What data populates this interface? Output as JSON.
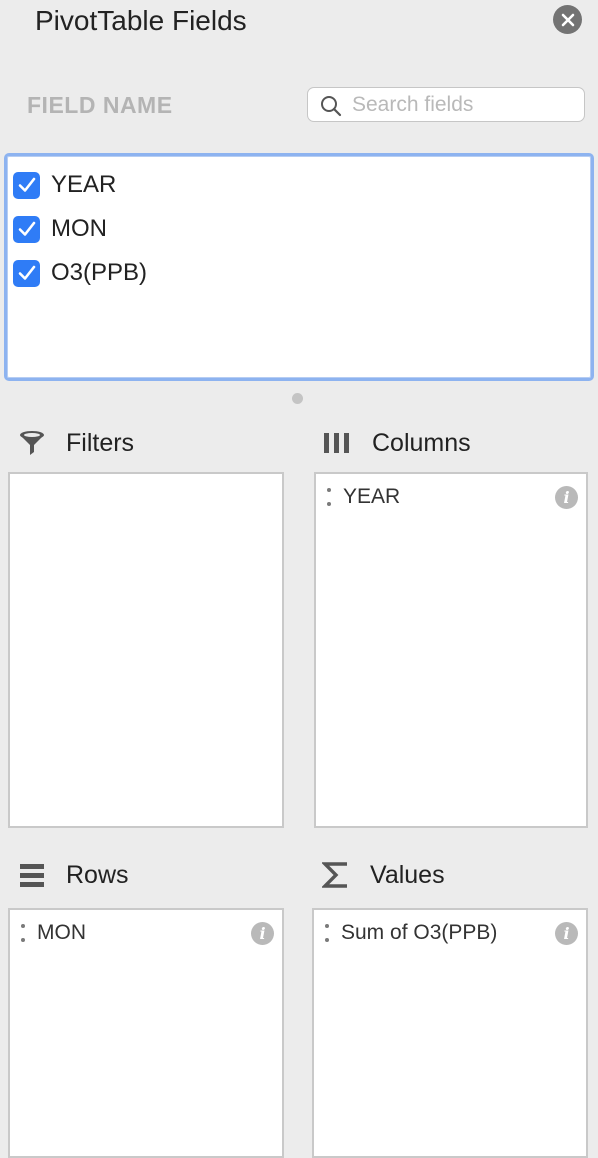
{
  "header": {
    "title": "PivotTable Fields"
  },
  "field_list": {
    "column_label": "FIELD NAME",
    "search_placeholder": "Search fields",
    "fields": [
      {
        "label": "YEAR",
        "checked": true
      },
      {
        "label": "MON",
        "checked": true
      },
      {
        "label": "O3(PPB)",
        "checked": true
      }
    ]
  },
  "areas": {
    "filters": {
      "label": "Filters",
      "icon": "filter-icon",
      "items": []
    },
    "columns": {
      "label": "Columns",
      "icon": "columns-icon",
      "items": [
        "YEAR"
      ]
    },
    "rows": {
      "label": "Rows",
      "icon": "rows-icon",
      "items": [
        "MON"
      ]
    },
    "values": {
      "label": "Values",
      "icon": "sigma-icon",
      "items": [
        "Sum of O3(PPB)"
      ]
    }
  },
  "colors": {
    "checkbox": "#2f7cf6",
    "focus_border": "#8db3f0",
    "panel_bg": "#ececec"
  }
}
